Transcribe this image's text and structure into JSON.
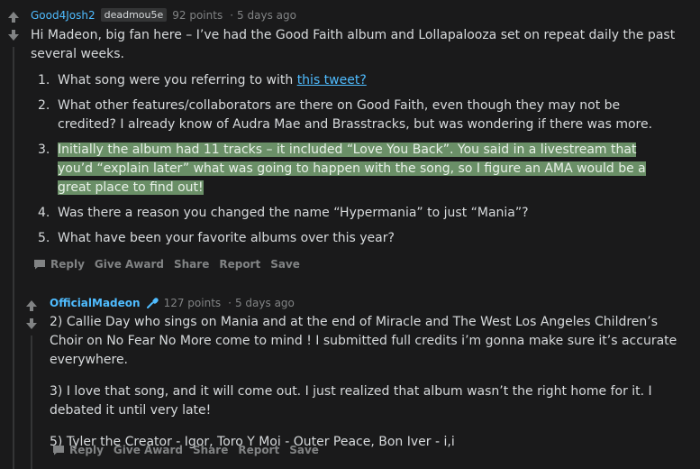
{
  "comment1": {
    "author": "Good4Josh2",
    "flair": "deadmou5e",
    "points": "92 points",
    "time": "5 days ago",
    "intro": "Hi Madeon, big fan here – I’ve had the Good Faith album and Lollapalooza set on repeat daily the past several weeks.",
    "items": [
      {
        "num": "1.",
        "text": "What song were you referring to with ",
        "link": "this tweet?"
      },
      {
        "num": "2.",
        "text": "What other features/collaborators are there on Good Faith, even though they may not be credited? I already know of Audra Mae and Brasstracks, but was wondering if there was more."
      },
      {
        "num": "3.",
        "text": "Initially the album had 11 tracks – it included “Love You Back”. You said in a livestream that you’d “explain later” what was going to happen with the song, so I figure an AMA would be a great place to find out!"
      },
      {
        "num": "4.",
        "text": "Was there a reason you changed the name “Hypermania” to just “Mania”?"
      },
      {
        "num": "5.",
        "text": "What have been your favorite albums over this year?"
      }
    ],
    "actions": {
      "reply": "Reply",
      "award": "Give Award",
      "share": "Share",
      "report": "Report",
      "save": "Save"
    }
  },
  "comment2": {
    "author": "OfficialMadeon",
    "points": "127 points",
    "time": "5 days ago",
    "paragraphs": [
      "2) Callie Day who sings on Mania and at the end of Miracle and The West Los Angeles Children’s Choir on No Fear No More come to mind ! I submitted full credits i’m gonna make sure it’s accurate everywhere.",
      "3) I love that song, and it will come out. I just realized that album wasn’t the right home for it. I debated it until very late!",
      "5) Tyler the Creator - Igor, Toro Y Moi - Outer Peace, Bon Iver - i,i"
    ],
    "actions": {
      "reply": "Reply",
      "award": "Give Award",
      "share": "Share",
      "report": "Report",
      "save": "Save"
    }
  },
  "colors": {
    "background": "#1a1a1b",
    "link": "#4fbcff",
    "highlight": "#6a8f67",
    "meta": "#818384"
  },
  "icons": [
    "upvote-icon",
    "downvote-icon",
    "chat-bubble-icon",
    "verified-mic-icon"
  ]
}
